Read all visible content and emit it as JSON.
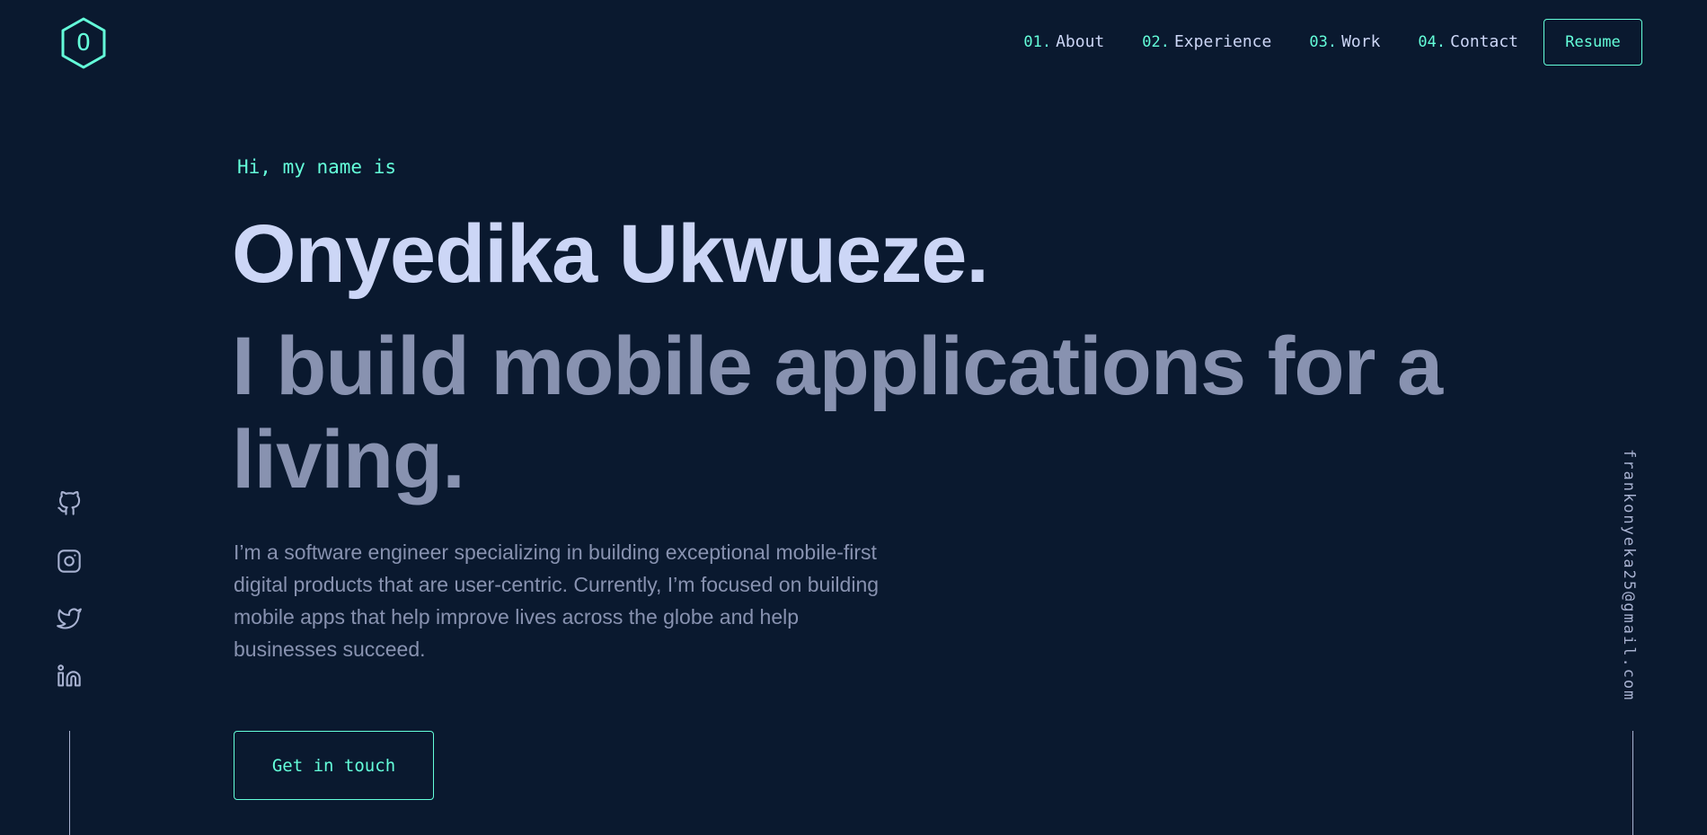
{
  "header": {
    "logo": {
      "letter": "O",
      "icon": "hexagon-logo-icon"
    },
    "nav": [
      {
        "num": "01.",
        "label": "About"
      },
      {
        "num": "02.",
        "label": "Experience"
      },
      {
        "num": "03.",
        "label": "Work"
      },
      {
        "num": "04.",
        "label": "Contact"
      }
    ],
    "resume_label": "Resume"
  },
  "hero": {
    "intro": "Hi, my name is",
    "name": "Onyedika Ukwueze.",
    "tagline": "I build mobile applications for a living.",
    "description": "I’m a software engineer specializing in building exceptional mobile-first digital products that are user-centric. Currently, I’m focused on building mobile apps that help improve lives across the globe and help businesses succeed.",
    "cta_label": "Get in touch"
  },
  "social": [
    {
      "icon": "github-icon"
    },
    {
      "icon": "instagram-icon"
    },
    {
      "icon": "twitter-icon"
    },
    {
      "icon": "linkedin-icon"
    }
  ],
  "email": "frankonyeka25@gmail.com",
  "colors": {
    "background": "#0a192f",
    "accent": "#64ffda",
    "heading": "#ccd6f6",
    "body": "#8892b0"
  }
}
